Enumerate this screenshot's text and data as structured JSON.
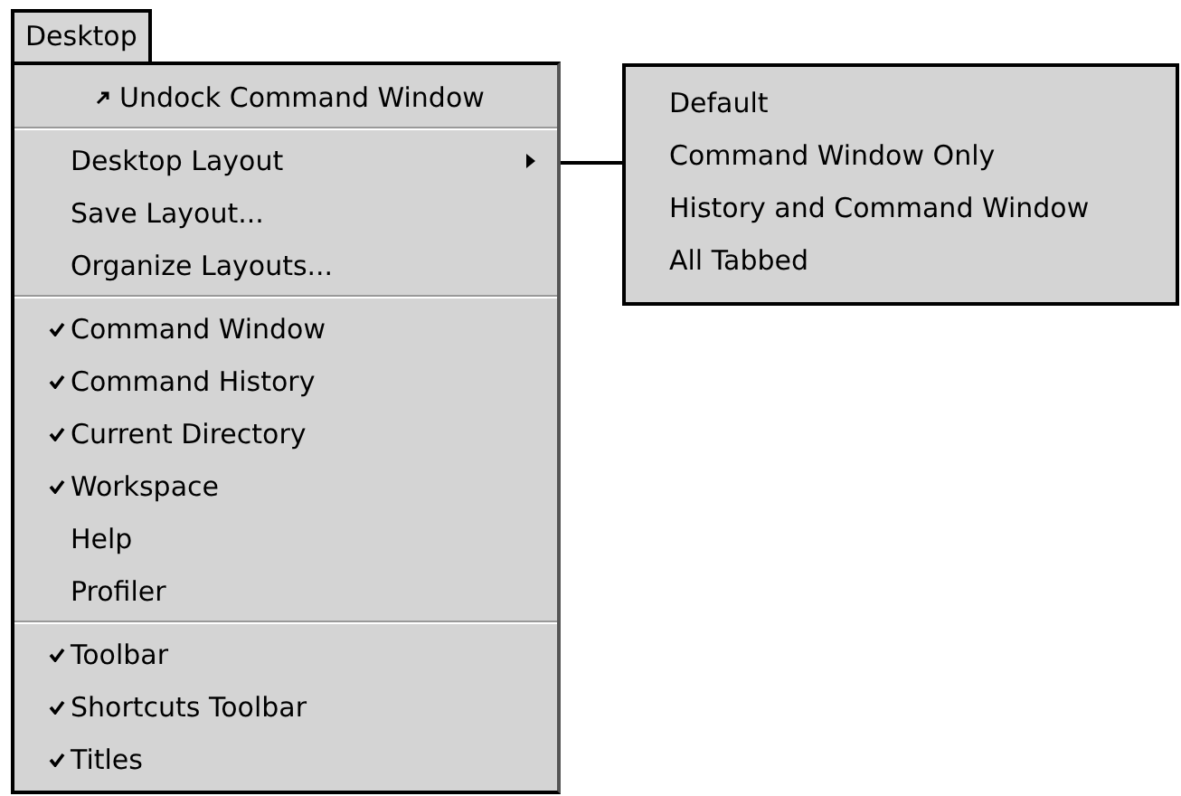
{
  "menu_bar": {
    "title": "Desktop",
    "selected": true
  },
  "menu": {
    "sections": [
      [
        {
          "label": "Undock Command Window",
          "kind": "undock",
          "checked": false
        }
      ],
      [
        {
          "label": "Desktop Layout",
          "kind": "submenu",
          "checked": false
        },
        {
          "label": "Save Layout...",
          "kind": "command",
          "checked": false
        },
        {
          "label": "Organize Layouts...",
          "kind": "command",
          "checked": false
        }
      ],
      [
        {
          "label": "Command Window",
          "kind": "command",
          "checked": true
        },
        {
          "label": "Command History",
          "kind": "command",
          "checked": true
        },
        {
          "label": "Current Directory",
          "kind": "command",
          "checked": true
        },
        {
          "label": "Workspace",
          "kind": "command",
          "checked": true
        },
        {
          "label": "Help",
          "kind": "command",
          "checked": false
        },
        {
          "label": "Profiler",
          "kind": "command",
          "checked": false
        }
      ],
      [
        {
          "label": "Toolbar",
          "kind": "command",
          "checked": true
        },
        {
          "label": "Shortcuts Toolbar",
          "kind": "command",
          "checked": true
        },
        {
          "label": "Titles",
          "kind": "command",
          "checked": true
        }
      ]
    ]
  },
  "submenu": {
    "items": [
      {
        "label": "Default"
      },
      {
        "label": "Command Window Only"
      },
      {
        "label": "History and Command Window"
      },
      {
        "label": "All Tabbed"
      }
    ]
  }
}
